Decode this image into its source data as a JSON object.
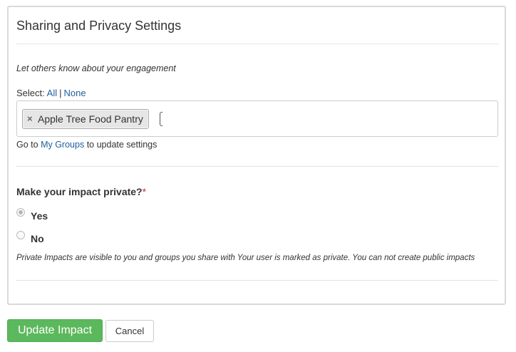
{
  "panel": {
    "title": "Sharing and Privacy Settings"
  },
  "sharing": {
    "intro": "Let others know about your engagement",
    "select_label": "Select:",
    "select_all": "All",
    "select_separator": "|",
    "select_none": "None",
    "tags": [
      {
        "remove_glyph": "×",
        "label": "Apple Tree Food Pantry"
      }
    ],
    "goto_prefix": "Go to",
    "goto_link": "My Groups",
    "goto_suffix": "to update settings"
  },
  "privacy": {
    "question": "Make your impact private?",
    "required_mark": "*",
    "options": [
      {
        "label": "Yes",
        "checked": true
      },
      {
        "label": "No",
        "checked": false
      }
    ],
    "note": "Private Impacts are visible to you and groups you share with Your user is marked as private. You can not create public impacts"
  },
  "actions": {
    "update_label": "Update Impact",
    "cancel_label": "Cancel"
  },
  "colors": {
    "primary": "#5cb85c",
    "link": "#1f5f9e",
    "required": "#c9302c"
  }
}
